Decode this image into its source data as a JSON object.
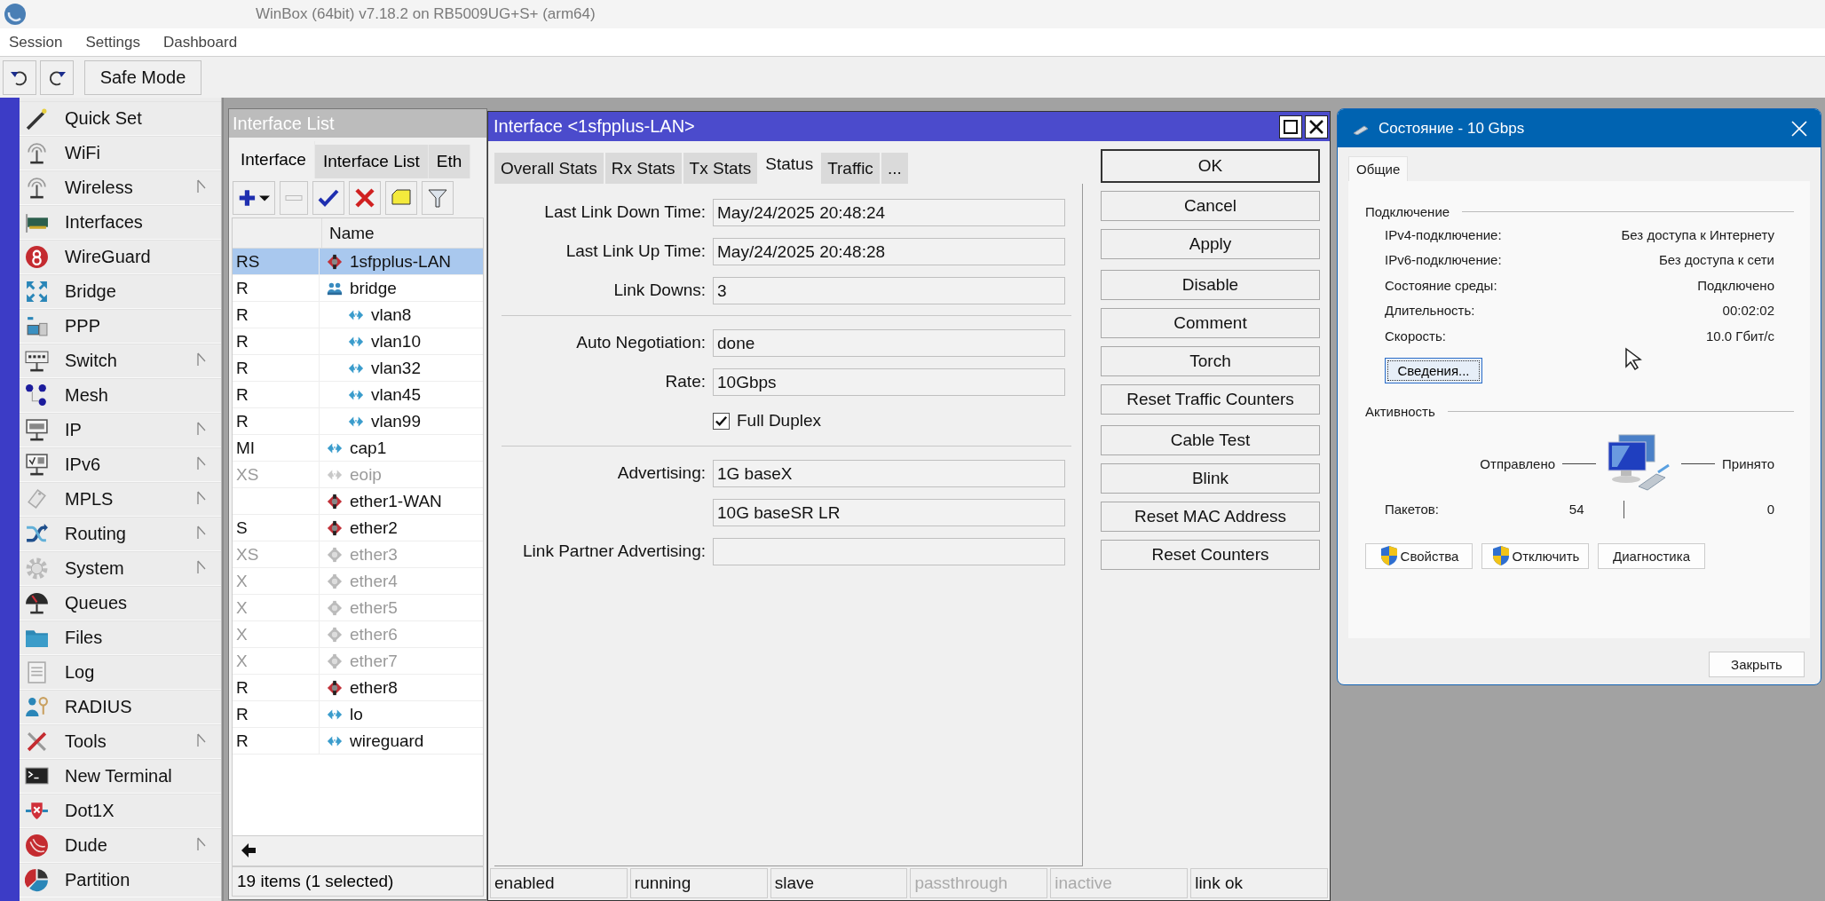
{
  "window": {
    "title": "WinBox (64bit) v7.18.2 on RB5009UG+S+ (arm64)"
  },
  "menu": [
    "Session",
    "Settings",
    "Dashboard"
  ],
  "toolbar": {
    "safe_mode": "Safe Mode"
  },
  "sidebar": {
    "items": [
      {
        "label": "Quick Set",
        "submenu": false
      },
      {
        "label": "WiFi",
        "submenu": false
      },
      {
        "label": "Wireless",
        "submenu": true
      },
      {
        "label": "Interfaces",
        "submenu": false
      },
      {
        "label": "WireGuard",
        "submenu": false
      },
      {
        "label": "Bridge",
        "submenu": false
      },
      {
        "label": "PPP",
        "submenu": false
      },
      {
        "label": "Switch",
        "submenu": true
      },
      {
        "label": "Mesh",
        "submenu": false
      },
      {
        "label": "IP",
        "submenu": true
      },
      {
        "label": "IPv6",
        "submenu": true
      },
      {
        "label": "MPLS",
        "submenu": true
      },
      {
        "label": "Routing",
        "submenu": true
      },
      {
        "label": "System",
        "submenu": true
      },
      {
        "label": "Queues",
        "submenu": false
      },
      {
        "label": "Files",
        "submenu": false
      },
      {
        "label": "Log",
        "submenu": false
      },
      {
        "label": "RADIUS",
        "submenu": false
      },
      {
        "label": "Tools",
        "submenu": true
      },
      {
        "label": "New Terminal",
        "submenu": false
      },
      {
        "label": "Dot1X",
        "submenu": false
      },
      {
        "label": "Dude",
        "submenu": true
      },
      {
        "label": "Partition",
        "submenu": false
      }
    ]
  },
  "interface_list": {
    "title": "Interface List",
    "tabs": [
      {
        "label": "Interface",
        "selected": true
      },
      {
        "label": "Interface List",
        "selected": false
      },
      {
        "label": "Eth",
        "selected": false
      }
    ],
    "columns": [
      "Name"
    ],
    "rows": [
      {
        "flags": "RS",
        "name": "1sfpplus-LAN",
        "kind": "ethernet",
        "selected": true,
        "disabled": false
      },
      {
        "flags": "R",
        "name": "bridge",
        "kind": "bridge",
        "selected": false,
        "disabled": false,
        "children": [
          {
            "flags": "R",
            "name": "vlan8",
            "kind": "virtual",
            "selected": false,
            "disabled": false
          },
          {
            "flags": "R",
            "name": "vlan10",
            "kind": "virtual",
            "selected": false,
            "disabled": false
          },
          {
            "flags": "R",
            "name": "vlan32",
            "kind": "virtual",
            "selected": false,
            "disabled": false
          },
          {
            "flags": "R",
            "name": "vlan45",
            "kind": "virtual",
            "selected": false,
            "disabled": false
          },
          {
            "flags": "R",
            "name": "vlan99",
            "kind": "virtual",
            "selected": false,
            "disabled": false
          }
        ]
      },
      {
        "flags": "MI",
        "name": "cap1",
        "kind": "virtual",
        "selected": false,
        "disabled": false
      },
      {
        "flags": "XS",
        "name": "eoip",
        "kind": "virtual",
        "selected": false,
        "disabled": true
      },
      {
        "name": "ether1-WAN",
        "kind": "ethernet",
        "selected": false,
        "disabled": false
      },
      {
        "flags": "S",
        "name": "ether2",
        "kind": "ethernet",
        "selected": false,
        "disabled": false
      },
      {
        "flags": "XS",
        "name": "ether3",
        "kind": "ethernet",
        "selected": false,
        "disabled": true
      },
      {
        "flags": "X",
        "name": "ether4",
        "kind": "ethernet",
        "selected": false,
        "disabled": true
      },
      {
        "flags": "X",
        "name": "ether5",
        "kind": "ethernet",
        "selected": false,
        "disabled": true
      },
      {
        "flags": "X",
        "name": "ether6",
        "kind": "ethernet",
        "selected": false,
        "disabled": true
      },
      {
        "flags": "X",
        "name": "ether7",
        "kind": "ethernet",
        "selected": false,
        "disabled": true
      },
      {
        "flags": "R",
        "name": "ether8",
        "kind": "ethernet",
        "selected": false,
        "disabled": false
      },
      {
        "flags": "R",
        "name": "lo",
        "kind": "virtual",
        "selected": false,
        "disabled": false
      },
      {
        "flags": "R",
        "name": "wireguard",
        "kind": "virtual",
        "selected": false,
        "disabled": false
      }
    ],
    "status": "19 items (1 selected)"
  },
  "dialog": {
    "title": "Interface <1sfpplus-LAN>",
    "tabs": [
      {
        "label": "Overall Stats",
        "selected": false
      },
      {
        "label": "Rx Stats",
        "selected": false
      },
      {
        "label": "Tx Stats",
        "selected": false
      },
      {
        "label": "Status",
        "selected": true
      },
      {
        "label": "Traffic",
        "selected": false
      },
      {
        "label": "...",
        "selected": false
      }
    ],
    "fields": [
      {
        "kind": "field",
        "label": "Last Link Down Time:",
        "value": "May/24/2025 20:48:24"
      },
      {
        "kind": "field",
        "label": "Last Link Up Time:",
        "value": "May/24/2025 20:48:28"
      },
      {
        "kind": "field",
        "label": "Link Downs:",
        "value": "3"
      },
      {
        "kind": "separator"
      },
      {
        "kind": "field",
        "label": "Auto Negotiation:",
        "value": "done"
      },
      {
        "kind": "field",
        "label": "Rate:",
        "value": "10Gbps"
      },
      {
        "kind": "checkbox",
        "label": "Full Duplex",
        "checked": true
      },
      {
        "kind": "separator"
      },
      {
        "kind": "field",
        "label": "Advertising:",
        "value": "1G baseX"
      },
      {
        "kind": "field",
        "value": "10G baseSR LR"
      },
      {
        "kind": "field",
        "label": "Link Partner Advertising:"
      }
    ],
    "button_groups": [
      [
        {
          "label": "OK",
          "default": true
        },
        {
          "label": "Cancel",
          "default": false
        },
        {
          "label": "Apply",
          "default": false
        }
      ],
      [
        {
          "label": "Disable",
          "default": false
        },
        {
          "label": "Comment",
          "default": false
        },
        {
          "label": "Torch",
          "default": false
        },
        {
          "label": "Reset Traffic Counters",
          "default": false
        }
      ],
      [
        {
          "label": "Cable Test",
          "default": false
        },
        {
          "label": "Blink",
          "default": false
        },
        {
          "label": "Reset MAC Address",
          "default": false
        },
        {
          "label": "Reset Counters",
          "default": false
        }
      ]
    ],
    "status_bar": [
      {
        "text": "enabled",
        "disabled": false
      },
      {
        "text": "running",
        "disabled": false
      },
      {
        "text": "slave",
        "disabled": false
      },
      {
        "text": "passthrough",
        "disabled": true
      },
      {
        "text": "inactive",
        "disabled": true
      },
      {
        "text": "link ok",
        "disabled": false
      }
    ]
  },
  "status_window": {
    "title": "Состояние - 10 Gbps",
    "tabs": [
      {
        "label": "Общие",
        "selected": true
      }
    ],
    "connection": {
      "heading": "Подключение",
      "rows": [
        {
          "label": "IPv4-подключение:",
          "value": "Без доступа к Интернету"
        },
        {
          "label": "IPv6-подключение:",
          "value": "Без доступа к сети"
        },
        {
          "label": "Состояние среды:",
          "value": "Подключено"
        },
        {
          "label": "Длительность:",
          "value": "00:02:02"
        },
        {
          "label": "Скорость:",
          "value": "10.0 Гбит/с"
        }
      ],
      "details_button": "Сведения..."
    },
    "activity": {
      "heading": "Активность",
      "sent_label": "Отправлено",
      "received_label": "Принято",
      "packets_label": "Пакетов:",
      "sent": "54",
      "received": "0"
    },
    "buttons": [
      {
        "label": "Свойства",
        "shield": true
      },
      {
        "label": "Отключить",
        "shield": true
      },
      {
        "label": "Диагностика",
        "shield": false
      }
    ],
    "close_button": "Закрыть"
  }
}
